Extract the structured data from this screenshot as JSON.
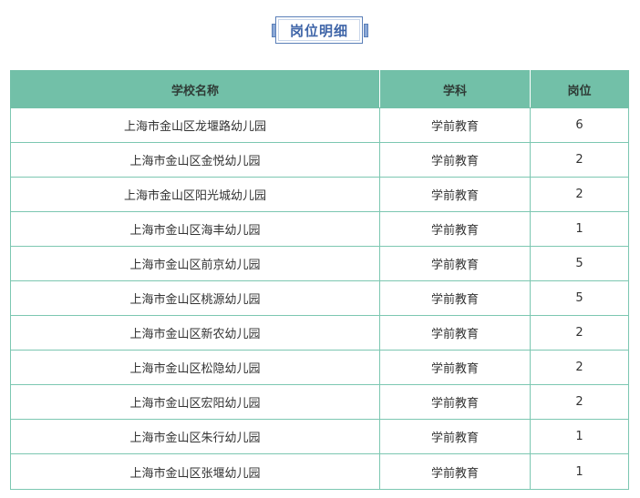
{
  "title": "岗位明细",
  "table": {
    "headers": [
      "学校名称",
      "学科",
      "岗位"
    ],
    "rows": [
      {
        "school": "上海市金山区龙堰路幼儿园",
        "subject": "学前教育",
        "positions": "6"
      },
      {
        "school": "上海市金山区金悦幼儿园",
        "subject": "学前教育",
        "positions": "2"
      },
      {
        "school": "上海市金山区阳光城幼儿园",
        "subject": "学前教育",
        "positions": "2"
      },
      {
        "school": "上海市金山区海丰幼儿园",
        "subject": "学前教育",
        "positions": "1"
      },
      {
        "school": "上海市金山区前京幼儿园",
        "subject": "学前教育",
        "positions": "5"
      },
      {
        "school": "上海市金山区桃源幼儿园",
        "subject": "学前教育",
        "positions": "5"
      },
      {
        "school": "上海市金山区新农幼儿园",
        "subject": "学前教育",
        "positions": "2"
      },
      {
        "school": "上海市金山区松隐幼儿园",
        "subject": "学前教育",
        "positions": "2"
      },
      {
        "school": "上海市金山区宏阳幼儿园",
        "subject": "学前教育",
        "positions": "2"
      },
      {
        "school": "上海市金山区朱行幼儿园",
        "subject": "学前教育",
        "positions": "1"
      },
      {
        "school": "上海市金山区张堰幼儿园",
        "subject": "学前教育",
        "positions": "1"
      }
    ]
  },
  "colors": {
    "header_bg": "#72c0a8",
    "border": "#7cc7b1",
    "title_text": "#3f65a8",
    "title_border": "#5b7fb8"
  }
}
